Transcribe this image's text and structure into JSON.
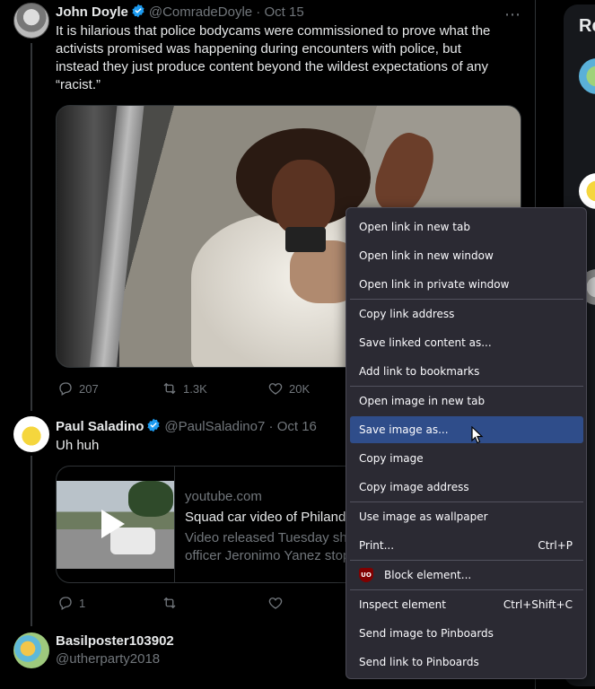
{
  "tweets": [
    {
      "name": "John Doyle",
      "handle": "@ComradeDoyle",
      "date": "Oct 15",
      "text_lines": [
        "It is hilarious that police bodycams were commissioned to prove what the",
        "activists promised was happening during encounters with police, but",
        "instead they just produce content beyond the wildest expectations of any",
        "“racist.”"
      ],
      "replies": "207",
      "retweets": "1.3K",
      "likes": "20K"
    },
    {
      "name": "Paul Saladino",
      "handle": "@PaulSaladino7",
      "date": "Oct 16",
      "text": "Uh huh",
      "card": {
        "domain": "youtube.com",
        "title": "Squad car video of Philando Castile shooting",
        "desc_line1": "Video released Tuesday shows the moment police",
        "desc_line2": "officer Jeronimo Yanez stopped Philando Castile"
      },
      "replies": "1"
    },
    {
      "name": "Basilposter103902",
      "handle": "@utherparty2018"
    }
  ],
  "sidebar": {
    "heading": "Re"
  },
  "context_menu": {
    "items": [
      {
        "label": "Open link in new tab"
      },
      {
        "label": "Open link in new window"
      },
      {
        "label": "Open link in private window"
      },
      {
        "label": "Copy link address"
      },
      {
        "label": "Save linked content as..."
      },
      {
        "label": "Add link to bookmarks"
      },
      {
        "label": "Open image in new tab"
      },
      {
        "label": "Save image as..."
      },
      {
        "label": "Copy image"
      },
      {
        "label": "Copy image address"
      },
      {
        "label": "Use image as wallpaper"
      },
      {
        "label": "Print...",
        "shortcut": "Ctrl+P"
      },
      {
        "label": "Block element..."
      },
      {
        "label": "Inspect element",
        "shortcut": "Ctrl+Shift+C"
      },
      {
        "label": "Send image to Pinboards"
      },
      {
        "label": "Send link to Pinboards"
      }
    ],
    "highlighted": "Save image as...",
    "ublock_badge": "UO"
  },
  "colors": {
    "background": "#000000",
    "accent": "#1d9bf0",
    "menu_bg": "#2b2a33",
    "menu_highlight": "#2f4d8a"
  }
}
